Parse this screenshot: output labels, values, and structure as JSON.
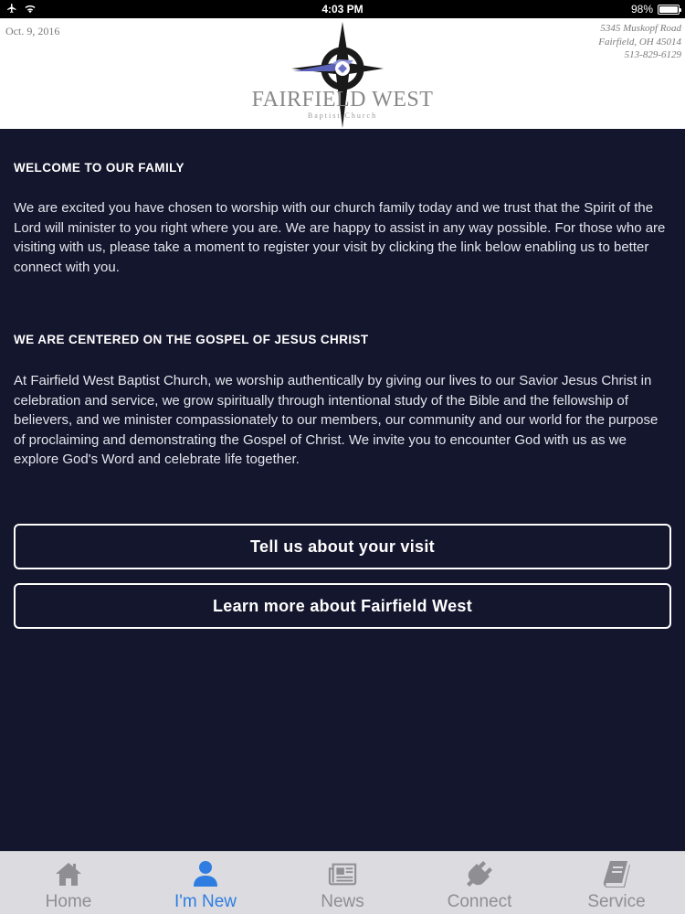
{
  "status_bar": {
    "time": "4:03 PM",
    "battery": "98%",
    "battery_level": 0.98
  },
  "header": {
    "date": "Oct. 9, 2016",
    "address_line1": "5345 Muskopf Road",
    "address_line2": "Fairfield, OH 45014",
    "phone": "513-829-6129",
    "logo_name": "FAIRFIELD WEST",
    "logo_sub": "Baptist Church"
  },
  "sections": [
    {
      "title": "WELCOME TO OUR FAMILY",
      "body": "We are excited you have chosen to worship with our church family today and we trust that the Spirit of the Lord will minister to you right where you are. We are happy to assist in any way possible. For those who are visiting with us, please take a moment to register your visit by clicking the link below enabling us to better connect with you."
    },
    {
      "title": "WE ARE CENTERED ON THE GOSPEL OF JESUS CHRIST",
      "body": "At Fairfield West Baptist Church, we worship authentically by giving our lives to our Savior Jesus Christ in celebration and service, we grow spiritually through intentional study of the Bible and the fellowship of believers, and we minister compassionately to our members, our community and our world for the purpose of proclaiming and demonstrating the Gospel of Christ. We invite you to encounter God with us as we explore God's Word and celebrate life together."
    }
  ],
  "buttons": {
    "visit": "Tell us about your visit",
    "learn": "Learn more about Fairfield West"
  },
  "tabs": [
    {
      "label": "Home",
      "icon": "house-icon"
    },
    {
      "label": "I'm New",
      "icon": "person-icon"
    },
    {
      "label": "News",
      "icon": "newspaper-icon"
    },
    {
      "label": "Connect",
      "icon": "plug-icon"
    },
    {
      "label": "Service",
      "icon": "book-icon"
    }
  ],
  "active_tab": "I'm New",
  "colors": {
    "background": "#13162d",
    "accent": "#2f7de1",
    "tabbar": "#dcdce0"
  }
}
